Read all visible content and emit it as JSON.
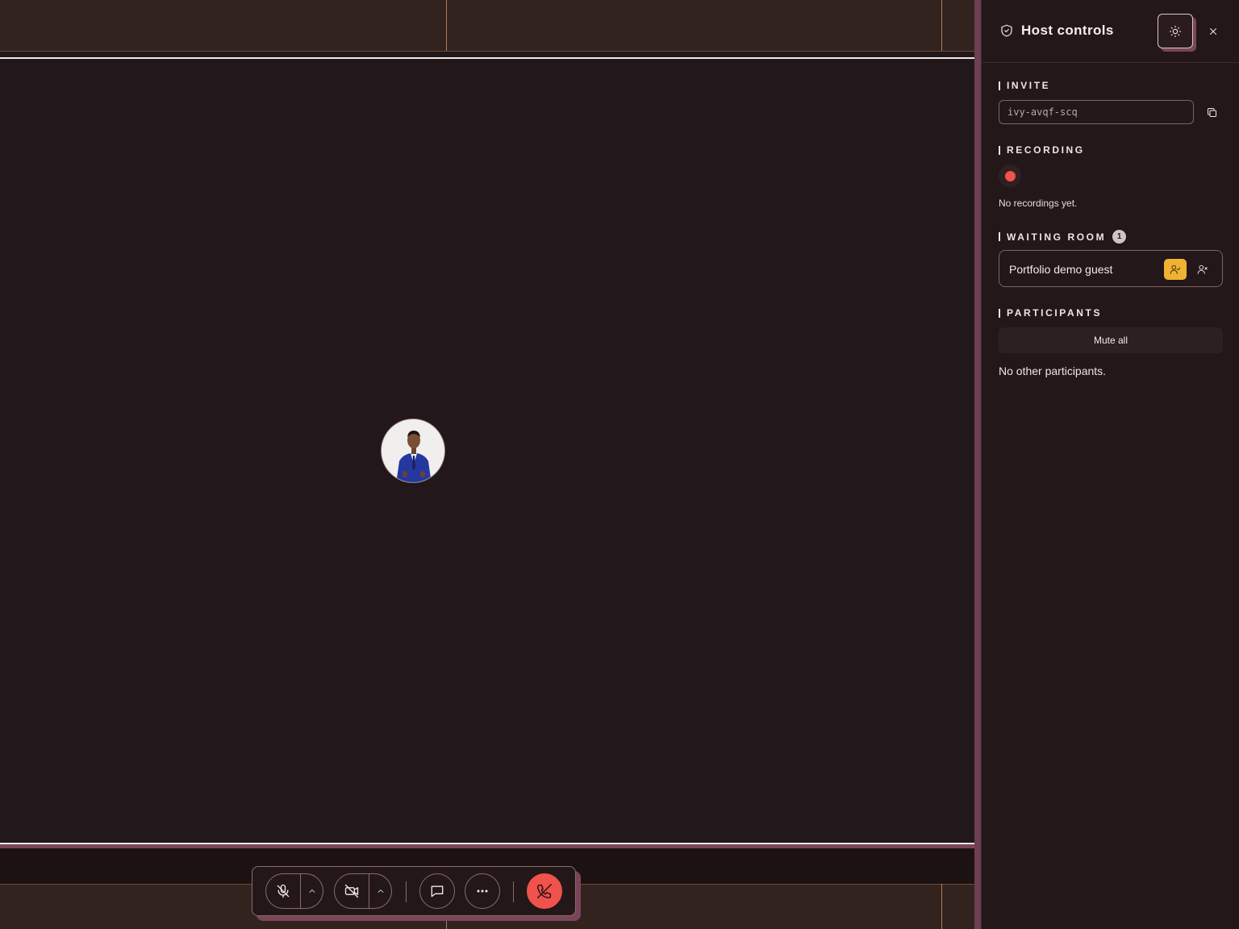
{
  "stage": {
    "participant_avatar_alt": "Participant avatar"
  },
  "controls": {
    "mic": "mic-off-icon",
    "camera": "camera-off-icon",
    "chat": "chat-icon",
    "more": "more-icon",
    "leave": "phone-off-icon"
  },
  "panel": {
    "title": "Host controls",
    "invite": {
      "heading": "INVITE",
      "code": "ivy-avqf-scq"
    },
    "recording": {
      "heading": "RECORDING",
      "empty": "No recordings yet."
    },
    "waiting_room": {
      "heading": "WAITING ROOM",
      "count": "1",
      "guests": [
        {
          "name": "Portfolio demo guest"
        }
      ]
    },
    "participants": {
      "heading": "PARTICIPANTS",
      "mute_all": "Mute all",
      "empty": "No other participants."
    }
  },
  "colors": {
    "accent_red": "#f0524c",
    "accent_yellow": "#efb233",
    "accent_pink": "#7a4559",
    "background": "#22171a"
  }
}
